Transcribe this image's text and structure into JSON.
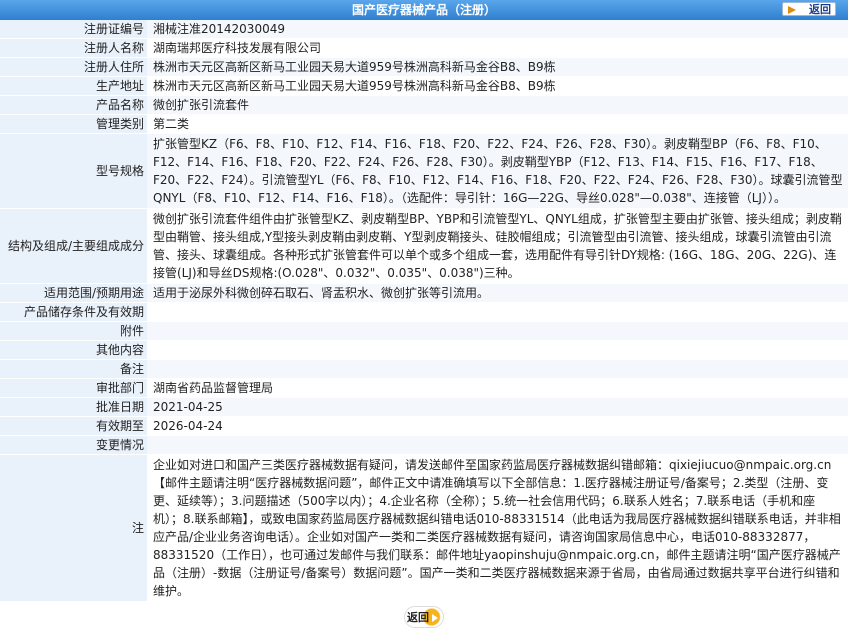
{
  "header": {
    "title": "国产医疗器械产品（注册）",
    "back_label": "返回"
  },
  "fields": {
    "reg_no": {
      "label": "注册证编号",
      "value": "湘械注准20142030049"
    },
    "registrant": {
      "label": "注册人名称",
      "value": "湖南瑞邦医疗科技发展有限公司"
    },
    "registrant_addr": {
      "label": "注册人住所",
      "value": "株洲市天元区高新区新马工业园天易大道959号株洲高科新马金谷B8、B9栋"
    },
    "production_addr": {
      "label": "生产地址",
      "value": "株洲市天元区高新区新马工业园天易大道959号株洲高科新马金谷B8、B9栋"
    },
    "product_name": {
      "label": "产品名称",
      "value": "微创扩张引流套件"
    },
    "category": {
      "label": "管理类别",
      "value": "第二类"
    },
    "model_spec": {
      "label": "型号规格",
      "value": "扩张管型KZ（F6、F8、F10、F12、F14、F16、F18、F20、F22、F24、F26、F28、F30）。剥皮鞘型BP（F6、F8、F10、F12、F14、F16、F18、F20、F22、F24、F26、F28、F30）。剥皮鞘型YBP（F12、F13、F14、F15、F16、F17、F18、F20、F22、F24）。引流管型YL（F6、F8、F10、F12、F14、F16、F18、F20、F22、F24、F26、F28、F30）。球囊引流管型QNYL（F8、F10、F12、F14、F16、F18）。（选配件：导引针：16G—22G、导丝0.028\"—0.038\"、连接管（LJ））。"
    },
    "structure": {
      "label": "结构及组成/主要组成成分",
      "value": "微创扩张引流套件组件由扩张管型KZ、剥皮鞘型BP、YBP和引流管型YL、QNYL组成，扩张管型主要由扩张管、接头组成；剥皮鞘型由鞘管、接头组成,Y型接头剥皮鞘由剥皮鞘、Y型剥皮鞘接头、硅胶帽组成；引流管型由引流管、接头组成，球囊引流管由引流管、接头、球囊组成。各种形式扩张管套件可以单个或多个组成一套，选用配件有导引针DY规格: (16G、18G、20G、22G)、连接管(LJ)和导丝DS规格:(O.028\"、0.032\"、0.035\"、0.038\")三种。"
    },
    "scope": {
      "label": "适用范围/预期用途",
      "value": "适用于泌尿外科微创碎石取石、肾盂积水、微创扩张等引流用。"
    },
    "storage": {
      "label": "产品储存条件及有效期",
      "value": ""
    },
    "attachment": {
      "label": "附件",
      "value": ""
    },
    "other": {
      "label": "其他内容",
      "value": ""
    },
    "remarks": {
      "label": "备注",
      "value": ""
    },
    "authority": {
      "label": "审批部门",
      "value": "湖南省药品监督管理局"
    },
    "approval_date": {
      "label": "批准日期",
      "value": "2021-04-25"
    },
    "valid_until": {
      "label": "有效期至",
      "value": "2026-04-24"
    },
    "changes": {
      "label": "变更情况",
      "value": ""
    },
    "note": {
      "label": "注",
      "value": "企业如对进口和国产三类医疗器械数据有疑问，请发送邮件至国家药监局医疗器械数据纠错邮箱：qixiejiucuo@nmpaic.org.cn【邮件主题请注明“医疗器械数据问题”，邮件正文中请准确填写以下全部信息：1.医疗器械注册证号/备案号；2.类型（注册、变更、延续等）；3.问题描述（500字以内）；4.企业名称（全称）；5.统一社会信用代码；6.联系人姓名；7.联系电话（手机和座机）；8.联系邮箱】，或致电国家药监局医疗器械数据纠错电话010-88331514（此电话为我局医疗器械数据纠错联系电话，并非相应产品/企业业务咨询电话）。企业如对国产一类和二类医疗器械数据有疑问，请咨询国家局信息中心，电话010-88332877，88331520（工作日），也可通过发邮件与我们联系：邮件地址yaopinshuju@nmpaic.org.cn，邮件主题请注明“国产医疗器械产品（注册）-数据（注册证号/备案号）数据问题”。国产一类和二类医疗器械数据来源于省局，由省局通过数据共享平台进行纠错和维护。"
    }
  },
  "footer": {
    "back_label": "返回"
  },
  "colors": {
    "header_bg": "#3f8fd8",
    "label_bg": "#e9f1fb",
    "accent": "#f7b31c"
  }
}
